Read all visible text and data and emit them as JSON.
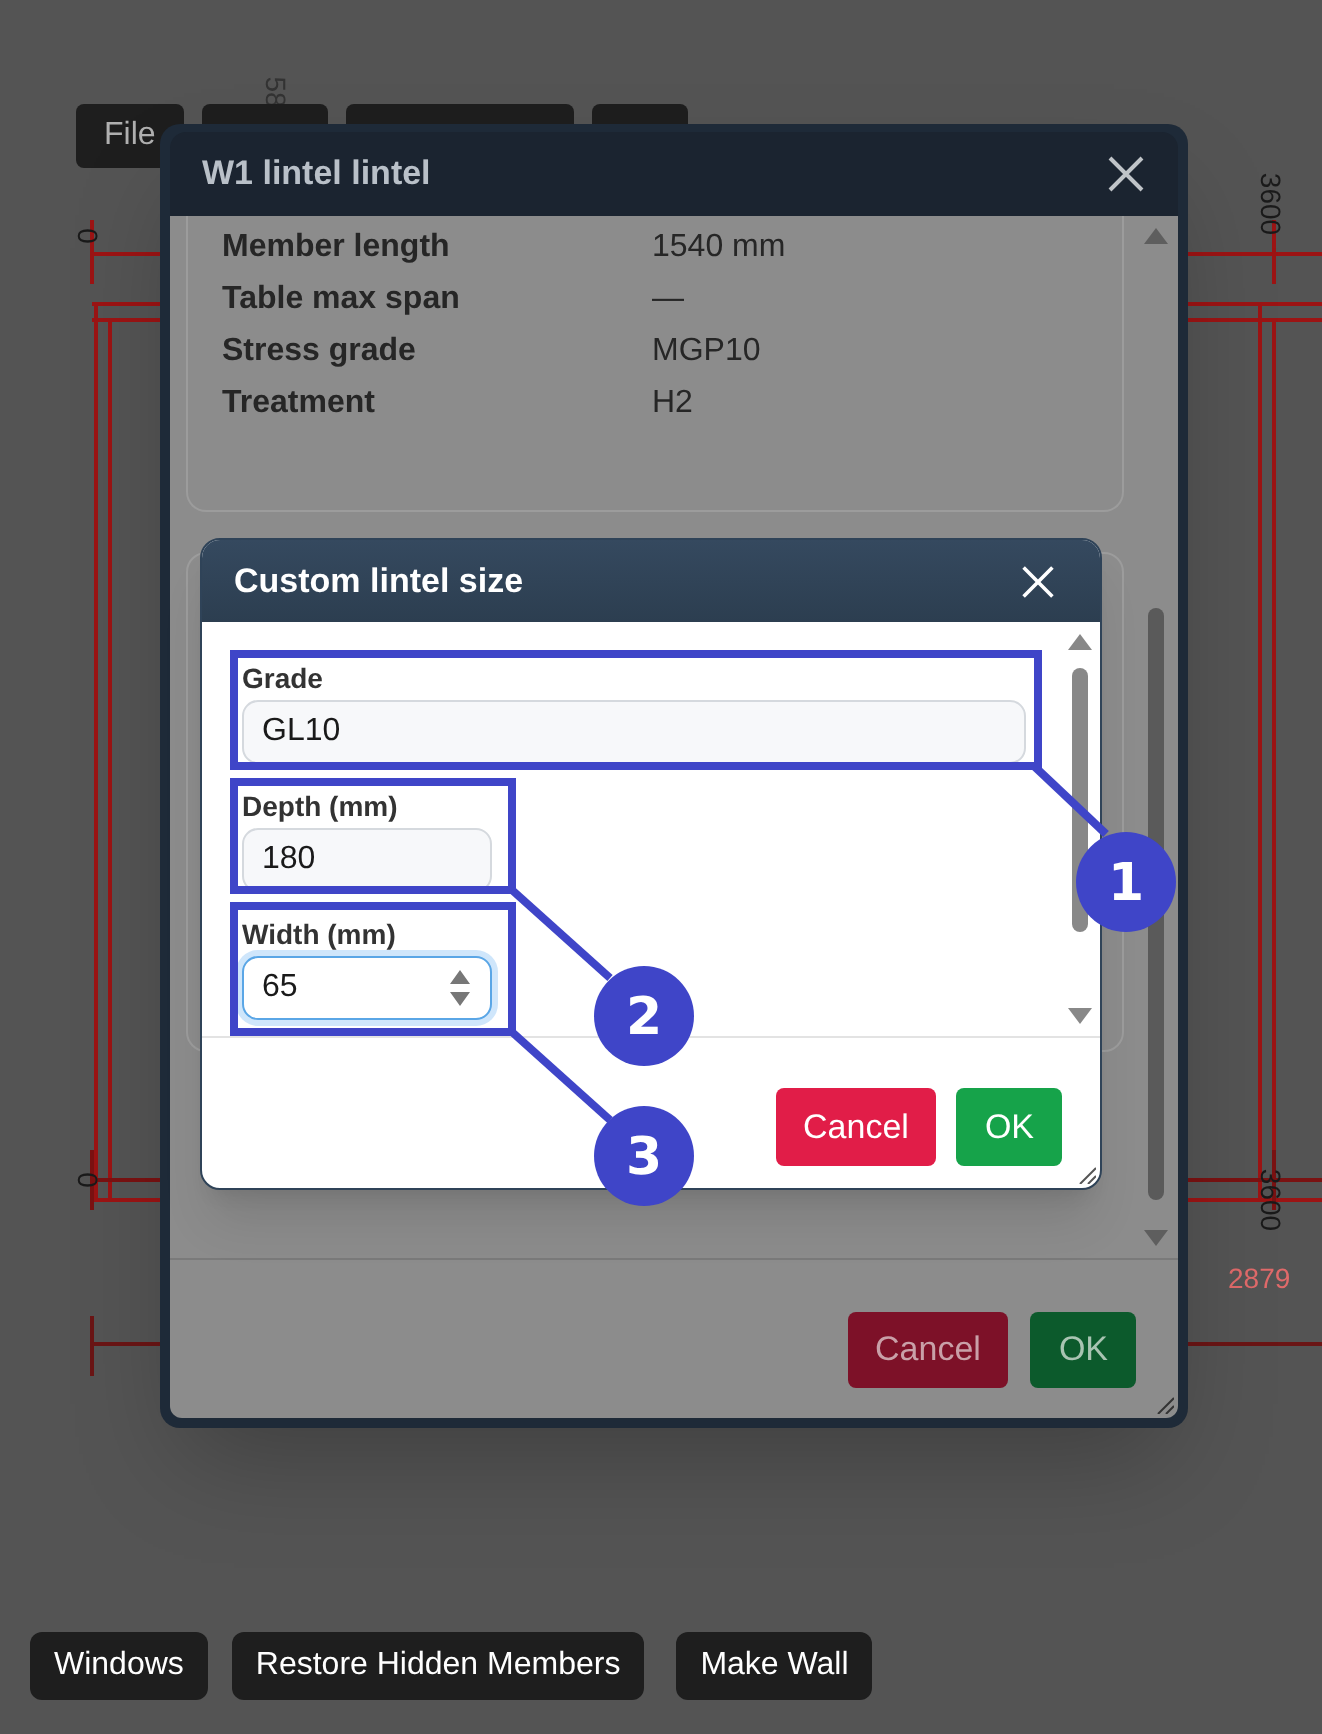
{
  "toolbar": [
    {
      "label": "File"
    }
  ],
  "plan_labels": [
    "58",
    "0",
    "3600",
    "0",
    "3600",
    "2879"
  ],
  "lintel_dialog": {
    "title": "W1 lintel lintel",
    "properties": [
      {
        "label": "Member length",
        "value": "1540 mm"
      },
      {
        "label": "Table max span",
        "value": "—"
      },
      {
        "label": "Stress grade",
        "value": "MGP10"
      },
      {
        "label": "Treatment",
        "value": "H2"
      }
    ],
    "buttons": [
      {
        "label": "Cancel",
        "kind": "cancel"
      },
      {
        "label": "OK",
        "kind": "ok"
      }
    ]
  },
  "custom_size_dialog": {
    "title": "Custom lintel size",
    "fields": [
      {
        "label": "Grade",
        "value": "GL10",
        "kind": "text",
        "focused": false
      },
      {
        "label": "Depth (mm)",
        "value": "180",
        "kind": "text",
        "focused": false
      },
      {
        "label": "Width (mm)",
        "value": "65",
        "kind": "number",
        "focused": true
      }
    ],
    "buttons": [
      {
        "label": "Cancel",
        "kind": "cancel"
      },
      {
        "label": "OK",
        "kind": "ok"
      }
    ]
  },
  "callouts": [
    {
      "number": "1"
    },
    {
      "number": "2"
    },
    {
      "number": "3"
    }
  ],
  "bottom_buttons": [
    {
      "label": "Windows"
    },
    {
      "label": "Restore Hidden Members"
    },
    {
      "label": "Make Wall"
    }
  ]
}
